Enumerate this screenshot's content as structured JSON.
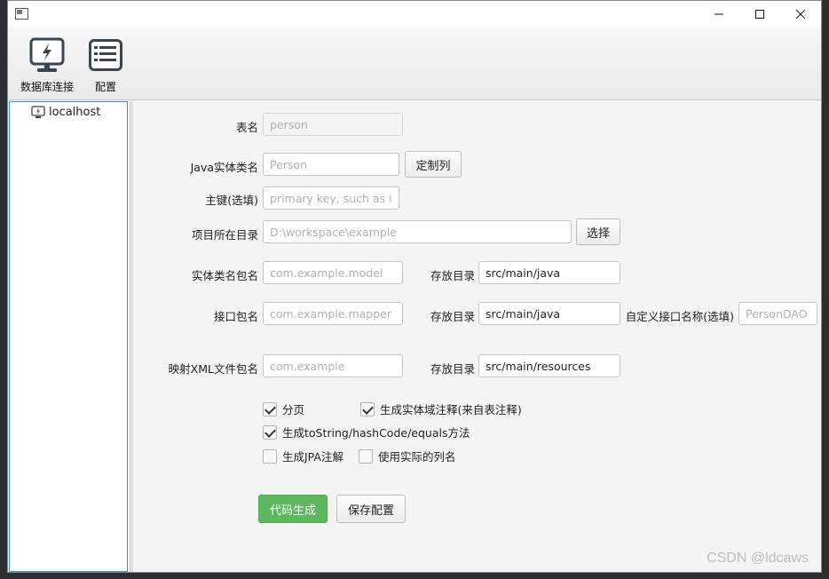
{
  "window": {
    "minimize_icon": "minimize-icon",
    "maximize_icon": "maximize-icon",
    "close_icon": "close-icon"
  },
  "toolbar": {
    "items": [
      {
        "label": "数据库连接",
        "icon": "database-connection-icon"
      },
      {
        "label": "配置",
        "icon": "config-list-icon"
      }
    ]
  },
  "sidebar": {
    "tree": [
      {
        "label": "localhost",
        "icon": "server-icon"
      }
    ]
  },
  "form": {
    "table_name": {
      "label": "表名",
      "value": "",
      "placeholder": "person"
    },
    "entity_class": {
      "label": "Java实体类名",
      "value": "",
      "placeholder": "Person",
      "button": "定制列"
    },
    "primary_key": {
      "label": "主键(选填)",
      "value": "",
      "placeholder": "primary key, such as id"
    },
    "project_dir": {
      "label": "项目所在目录",
      "value": "",
      "placeholder": "D:\\workspace\\example",
      "button": "选择"
    },
    "entity_package": {
      "label": "实体类名包名",
      "value": "",
      "placeholder": "com.example.model",
      "dir_label": "存放目录",
      "dir_value": "src/main/java"
    },
    "mapper_package": {
      "label": "接口包名",
      "value": "",
      "placeholder": "com.example.mapper",
      "dir_label": "存放目录",
      "dir_value": "src/main/java",
      "custom_label": "自定义接口名称(选填)",
      "custom_placeholder": "PersonDAO"
    },
    "xml_package": {
      "label": "映射XML文件包名",
      "value": "",
      "placeholder": "com.example",
      "dir_label": "存放目录",
      "dir_value": "src/main/resources"
    }
  },
  "options": [
    {
      "label": "分页",
      "checked": true
    },
    {
      "label": "生成实体域注释(来自表注释)",
      "checked": true
    },
    {
      "label": "生成toString/hashCode/equals方法",
      "checked": true
    },
    {
      "label": "生成JPA注解",
      "checked": false
    },
    {
      "label": "使用实际的列名",
      "checked": false
    }
  ],
  "actions": {
    "generate": "代码生成",
    "save": "保存配置"
  },
  "watermark": "CSDN @ldcaws",
  "colors": {
    "primary_button": "#5cb85c",
    "sidebar_border": "#3b8fd6"
  }
}
